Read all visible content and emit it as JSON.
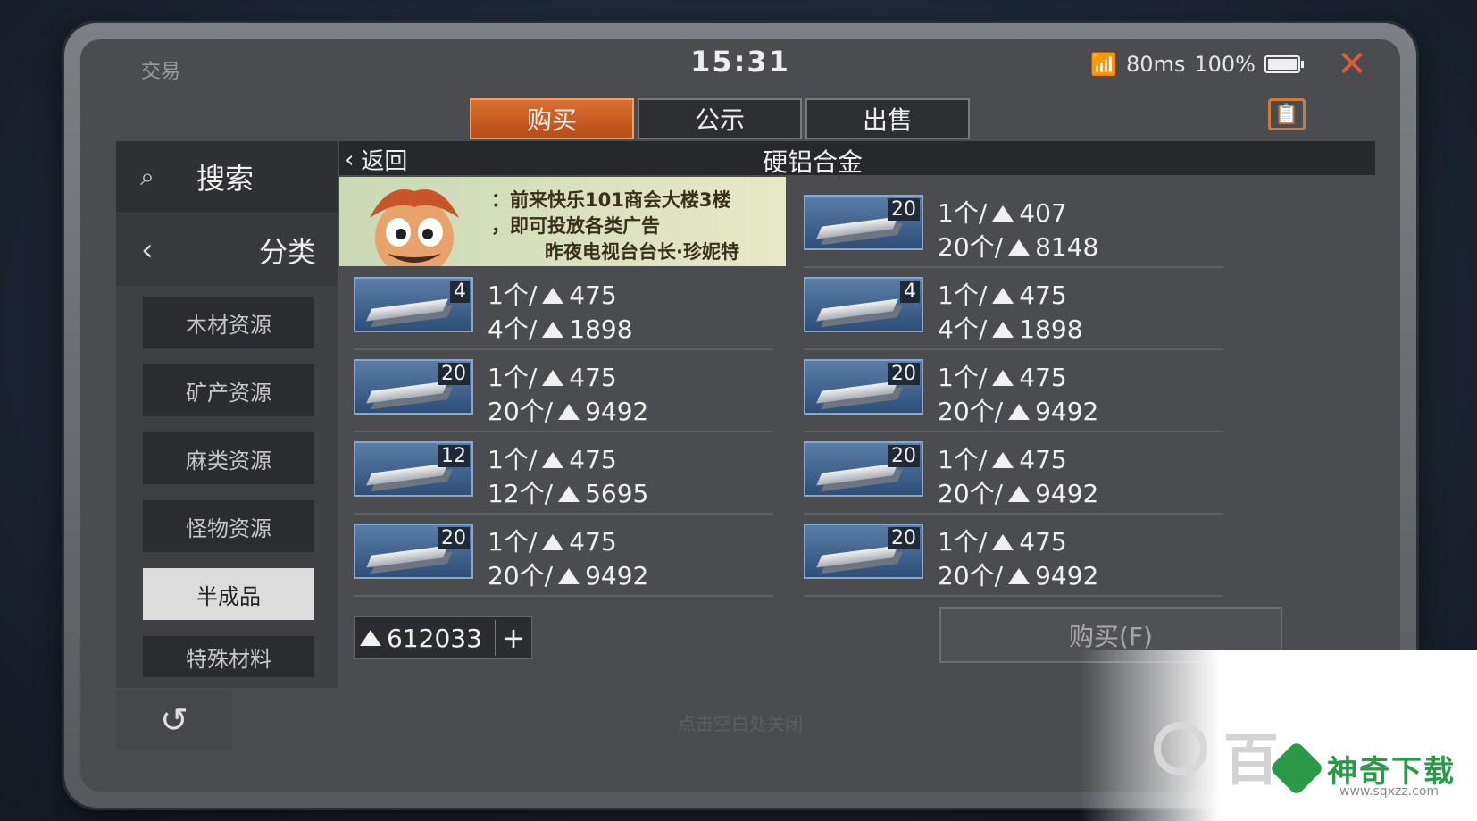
{
  "app": {
    "title": "交易",
    "clock": "15:31",
    "ping": "80ms",
    "battery": "100%",
    "close_glyph": "✕",
    "clipboard_glyph": "📋"
  },
  "tabs": [
    {
      "label": "购买",
      "active": true
    },
    {
      "label": "公示",
      "active": false
    },
    {
      "label": "出售",
      "active": false
    }
  ],
  "sidebar": {
    "search_label": "搜索",
    "category_label": "分类",
    "items": [
      {
        "label": "木材资源",
        "active": false
      },
      {
        "label": "矿产资源",
        "active": false
      },
      {
        "label": "麻类资源",
        "active": false
      },
      {
        "label": "怪物资源",
        "active": false
      },
      {
        "label": "半成品",
        "active": true
      },
      {
        "label": "特殊材料",
        "active": false
      }
    ]
  },
  "main": {
    "back_label": "返回",
    "title": "硬铝合金",
    "ad": {
      "line1": "：前来快乐101商会大楼3楼",
      "line2": "，即可投放各类广告",
      "line3": "昨夜电视台台长·珍妮特"
    },
    "listings_left": [
      {
        "count": "4",
        "unit": "1个/",
        "unit_price": "475",
        "total_label": "4个/",
        "total": "1898"
      },
      {
        "count": "20",
        "unit": "1个/",
        "unit_price": "475",
        "total_label": "20个/",
        "total": "9492"
      },
      {
        "count": "12",
        "unit": "1个/",
        "unit_price": "475",
        "total_label": "12个/",
        "total": "5695"
      },
      {
        "count": "20",
        "unit": "1个/",
        "unit_price": "475",
        "total_label": "20个/",
        "total": "9492"
      }
    ],
    "listings_right": [
      {
        "count": "20",
        "unit": "1个/",
        "unit_price": "407",
        "total_label": "20个/",
        "total": "8148"
      },
      {
        "count": "4",
        "unit": "1个/",
        "unit_price": "475",
        "total_label": "4个/",
        "total": "1898"
      },
      {
        "count": "20",
        "unit": "1个/",
        "unit_price": "475",
        "total_label": "20个/",
        "total": "9492"
      },
      {
        "count": "20",
        "unit": "1个/",
        "unit_price": "475",
        "total_label": "20个/",
        "total": "9492"
      },
      {
        "count": "20",
        "unit": "1个/",
        "unit_price": "475",
        "total_label": "20个/",
        "total": "9492"
      }
    ],
    "wallet": "612033",
    "wallet_plus": "+",
    "buy_label": "购买(F)"
  },
  "footer": {
    "undo_glyph": "↺",
    "hint": "点击空白处关闭"
  },
  "watermark": {
    "bai": "百",
    "brand": "神奇下载",
    "url": "www.sqxzz.com"
  }
}
